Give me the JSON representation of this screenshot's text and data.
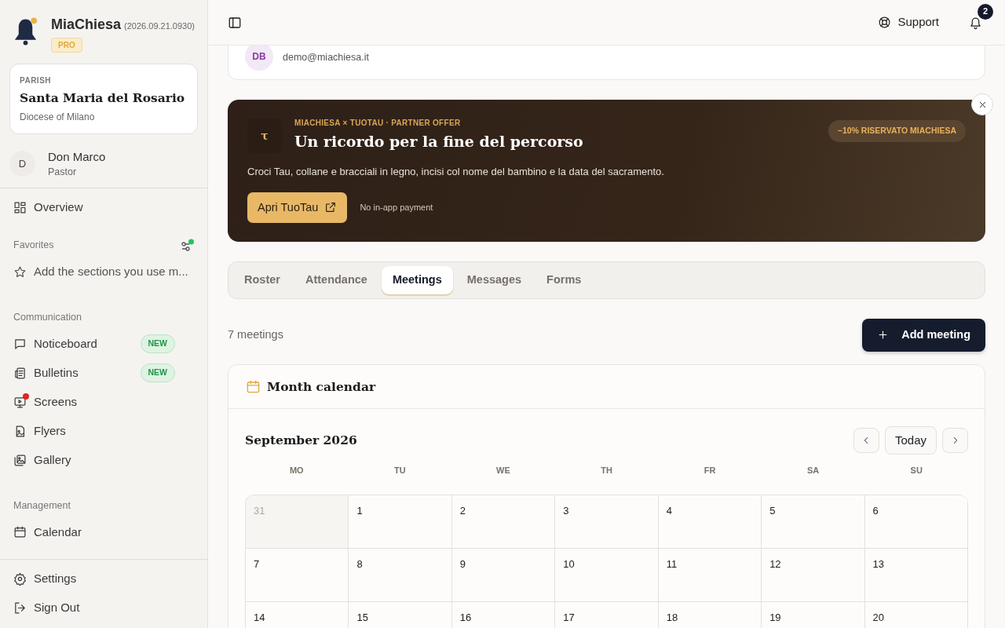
{
  "app": {
    "name": "MiaChiesa",
    "version": "(2026.09.21.0930)",
    "plan": "PRO"
  },
  "parish": {
    "label": "PARISH",
    "name": "Santa Maria del Rosario",
    "diocese": "Diocese of Milano"
  },
  "user": {
    "initial": "D",
    "name": "Don Marco",
    "role": "Pastor"
  },
  "overview": {
    "label": "Overview",
    "selected": false
  },
  "favorites": {
    "title": "Favorites",
    "indicator": true,
    "hint": "Add the sections you use m..."
  },
  "sections": [
    {
      "title": "Communication",
      "items": [
        {
          "label": "Noticeboard",
          "badge": "NEW",
          "alert": false
        },
        {
          "label": "Bulletins",
          "badge": "NEW",
          "alert": false
        },
        {
          "label": "Screens",
          "alert": true
        },
        {
          "label": "Flyers",
          "alert": false
        },
        {
          "label": "Gallery",
          "alert": false
        }
      ]
    },
    {
      "title": "Management",
      "items": [
        {
          "label": "Calendar",
          "alert": false
        }
      ]
    }
  ],
  "footer": [
    {
      "label": "Settings"
    },
    {
      "label": "Sign Out"
    }
  ],
  "header": {
    "support": "Support",
    "notifications": "2"
  },
  "profile_card": {
    "initials": "DB",
    "email": "demo@miachiesa.it"
  },
  "promo": {
    "logo": "τ",
    "eyebrow": "MIACHIESA × TUOTAU · PARTNER OFFER",
    "title": "Un ricordo per la fine del percorso",
    "discount": "−10% RISERVATO MIACHIESA",
    "text": "Croci Tau, collane e bracciali in legno, incisi col nome del bambino e la data del sacramento.",
    "button": "Apri TuoTau",
    "note": "No in-app payment"
  },
  "tabs": [
    {
      "label": "Roster",
      "selected": false
    },
    {
      "label": "Attendance",
      "selected": false
    },
    {
      "label": "Meetings",
      "selected": true
    },
    {
      "label": "Messages",
      "selected": false
    },
    {
      "label": "Forms",
      "selected": false
    }
  ],
  "meetings_count": "7 meetings",
  "add_button": "Add meeting",
  "calendar": {
    "title": "Month calendar",
    "month": "September 2026",
    "today": "Today",
    "weekdays": [
      "MO",
      "TU",
      "WE",
      "TH",
      "FR",
      "SA",
      "SU"
    ],
    "weeks": [
      [
        {
          "day": "31",
          "outside": true
        },
        {
          "day": "1",
          "outside": false
        },
        {
          "day": "2",
          "outside": false
        },
        {
          "day": "3",
          "outside": false
        },
        {
          "day": "4",
          "outside": false
        },
        {
          "day": "5",
          "outside": false
        },
        {
          "day": "6",
          "outside": false
        }
      ],
      [
        {
          "day": "7",
          "outside": false
        },
        {
          "day": "8",
          "outside": false
        },
        {
          "day": "9",
          "outside": false
        },
        {
          "day": "10",
          "outside": false
        },
        {
          "day": "11",
          "outside": false
        },
        {
          "day": "12",
          "outside": false
        },
        {
          "day": "13",
          "outside": false
        }
      ],
      [
        {
          "day": "14",
          "outside": false
        },
        {
          "day": "15",
          "outside": false
        },
        {
          "day": "16",
          "outside": false
        },
        {
          "day": "17",
          "outside": false
        },
        {
          "day": "18",
          "outside": false
        },
        {
          "day": "19",
          "outside": false
        },
        {
          "day": "20",
          "outside": false
        }
      ]
    ]
  }
}
